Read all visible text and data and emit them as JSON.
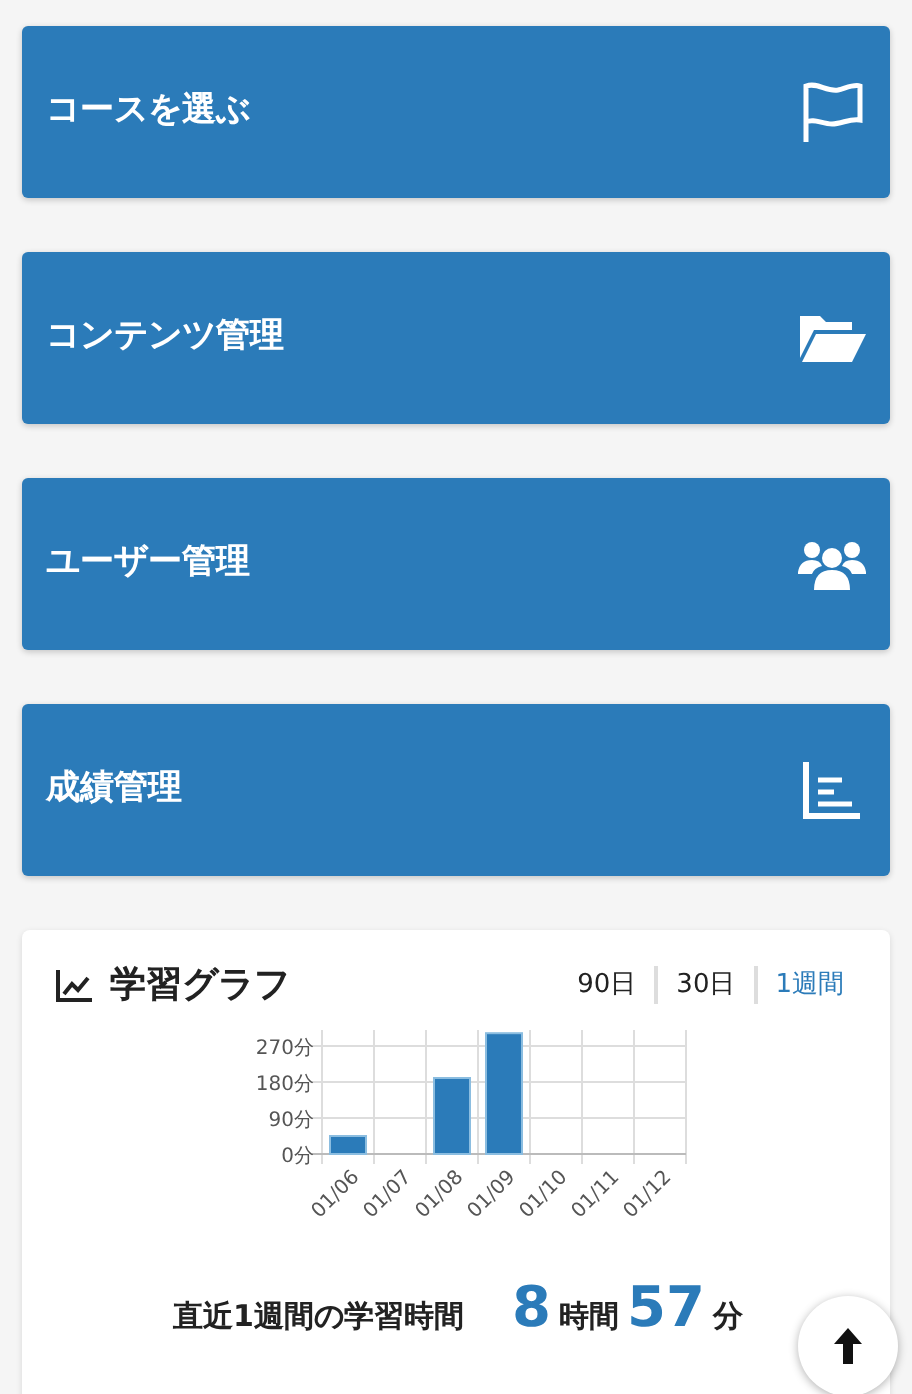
{
  "menu_tiles": [
    {
      "label": "コースを選ぶ",
      "kind": "flag"
    },
    {
      "label": "コンテンツ管理",
      "kind": "folder"
    },
    {
      "label": "ユーザー管理",
      "kind": "users"
    },
    {
      "label": "成績管理",
      "kind": "chart"
    }
  ],
  "graph_card": {
    "title": "学習グラフ",
    "periods": [
      {
        "label": "90日",
        "selected": false
      },
      {
        "label": "30日",
        "selected": false
      },
      {
        "label": "1週間",
        "selected": true
      }
    ],
    "chart_data": {
      "type": "bar",
      "categories": [
        "01/06",
        "01/07",
        "01/08",
        "01/09",
        "01/10",
        "01/11",
        "01/12"
      ],
      "series": [
        {
          "color": "#2b7bb9",
          "values": [
            45,
            0,
            190,
            302,
            0,
            0,
            0
          ]
        }
      ],
      "ylim": [
        0,
        310
      ],
      "grid": true,
      "yticks": [
        {
          "value": 0,
          "label": "0分"
        },
        {
          "value": 90,
          "label": "90分"
        },
        {
          "value": 180,
          "label": "180分"
        },
        {
          "value": 270,
          "label": "270分"
        }
      ]
    },
    "summary": {
      "label": "直近1週間の学習時間",
      "hours": "8",
      "hours_unit": "時間",
      "minutes": "57",
      "minutes_unit": "分"
    }
  }
}
